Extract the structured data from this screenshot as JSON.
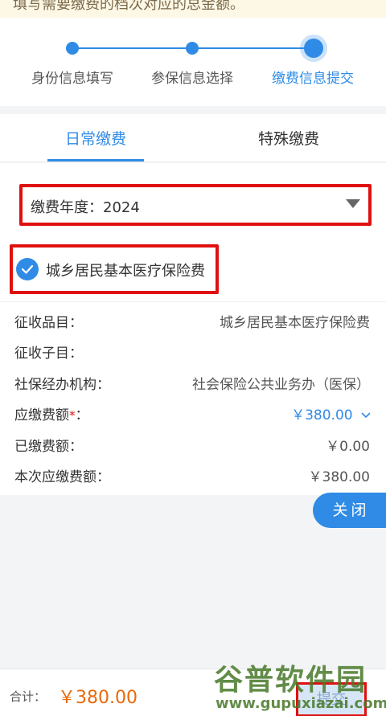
{
  "notice": {
    "text": "填写需要缴费的档次对应的总金额。"
  },
  "steps": [
    {
      "label": "身份信息填写"
    },
    {
      "label": "参保信息选择"
    },
    {
      "label": "缴费信息提交"
    }
  ],
  "tabs": [
    {
      "label": "日常缴费"
    },
    {
      "label": "特殊缴费"
    }
  ],
  "year_select": {
    "label": "缴费年度：2024"
  },
  "fee_item": {
    "label": "城乡居民基本医疗保险费",
    "checked": true
  },
  "details": [
    {
      "key": "征收品目：",
      "value": "城乡居民基本医疗保险费"
    },
    {
      "key": "征收子目：",
      "value": ""
    },
    {
      "key": "社保经办机构：",
      "value": "社会保险公共业务办（医保）"
    },
    {
      "key": "应缴费额",
      "required_mark": "*",
      "key_suffix": "：",
      "value": "￥380.00"
    },
    {
      "key": "已缴费额：",
      "value": "￥0.00"
    },
    {
      "key": "本次应缴费额：",
      "value": "￥380.00"
    }
  ],
  "close_button": {
    "label": "关闭"
  },
  "footer": {
    "total_label": "合计：",
    "total_value": "￥380.00",
    "submit_label": "提交"
  },
  "watermark": {
    "title": "谷普软件园",
    "url": "www.gupuxiazai.com"
  },
  "colors": {
    "accent": "#2f8be6",
    "highlight_border": "#e01010",
    "amount": "#e8690a"
  }
}
